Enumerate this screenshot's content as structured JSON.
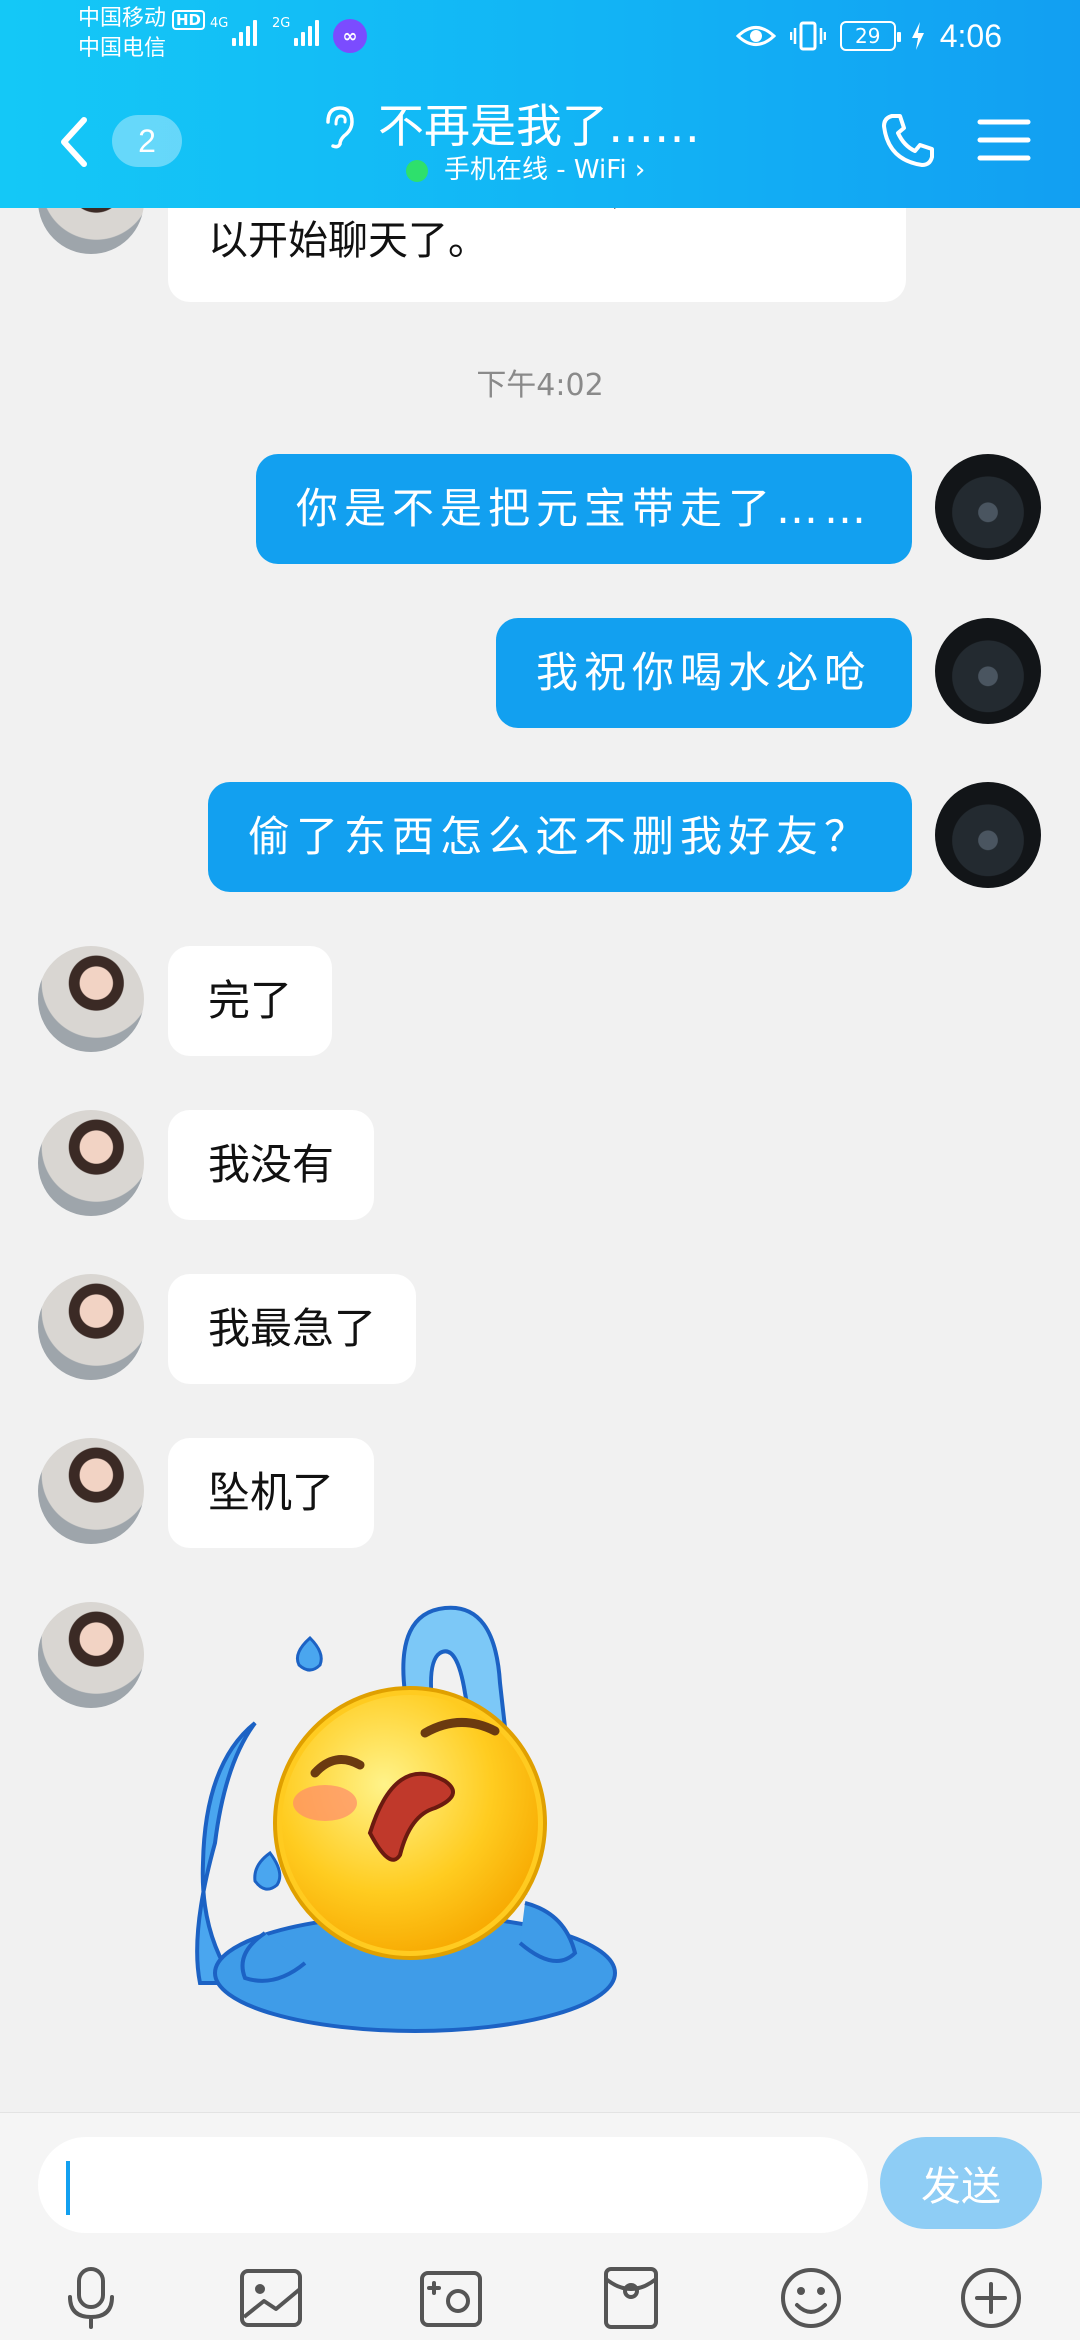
{
  "status_bar": {
    "carrier1": "中国移动",
    "carrier2": "中国电信",
    "hd_badge": "HD",
    "net1": "4G",
    "net2": "2G",
    "battery": "29",
    "time": "4:06"
  },
  "header": {
    "unread_count": "2",
    "title": "不再是我了……",
    "online_status": "手机在线 - WiFi ›"
  },
  "messages": {
    "partial_text": "我通过了你的好友请求，现在我们可以开始聊天了。",
    "time_divider": "下午4:02",
    "sent": [
      "你是不是把元宝带走了……",
      "我祝你喝水必呛",
      "偷了东西怎么还不删我好友？"
    ],
    "received": [
      "完了",
      "我没有",
      "我最急了",
      "坠机了"
    ],
    "sticker": "crying-emoji-sticker"
  },
  "input": {
    "value": "",
    "send_label": "发送"
  },
  "toolbar": {
    "icons": [
      "microphone-icon",
      "image-icon",
      "camera-icon",
      "red-packet-icon",
      "emoji-icon",
      "plus-icon"
    ]
  },
  "colors": {
    "header_blue": "#12b4f5",
    "sent_bubble": "#12a0f0",
    "send_button": "#8ecdf5",
    "online_dot": "#2ee06c"
  }
}
